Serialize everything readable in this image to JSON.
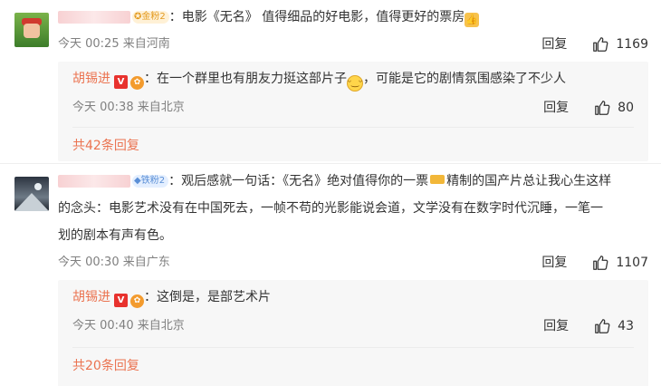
{
  "comments": [
    {
      "badge": "金粉2",
      "text": "电影《无名》 值得细品的好电影，值得更好的票房",
      "time": "今天 00:25",
      "location": "来自河南",
      "reply_label": "回复",
      "likes": "1169",
      "reply": {
        "author": "胡锡进",
        "text_a": "在一个群里也有朋友力挺这部片子",
        "text_b": "，可能是它的剧情氛围感染了不少人",
        "time": "今天 00:38",
        "location": "来自北京",
        "reply_label": "回复",
        "likes": "80"
      },
      "more": "共42条回复"
    },
    {
      "badge": "铁粉2",
      "text_a": "观后感就一句话：《无名》绝对值得你的一票",
      "text_b": "精制的国产片总让我心生这样",
      "text_c": "的念头：电影艺术没有在中国死去，一帧不苟的光影能说会道，文学没有在数字时代沉睡，一笔一",
      "text_d": "划的剧本有声有色。",
      "time": "今天 00:30",
      "location": "来自广东",
      "reply_label": "回复",
      "likes": "1107",
      "reply": {
        "author": "胡锡进",
        "text": "这倒是，是部艺术片",
        "time": "今天 00:40",
        "location": "来自北京",
        "reply_label": "回复",
        "likes": "43"
      },
      "more": "共20条回复"
    }
  ],
  "colors": {
    "accent": "#eb7350",
    "meta": "#808080",
    "reply_bg": "#f7f7f7"
  },
  "icons": [
    "thumbs-up-icon",
    "verified-v-icon",
    "medal-icon",
    "diamond-icon",
    "fan-badge-icon"
  ]
}
